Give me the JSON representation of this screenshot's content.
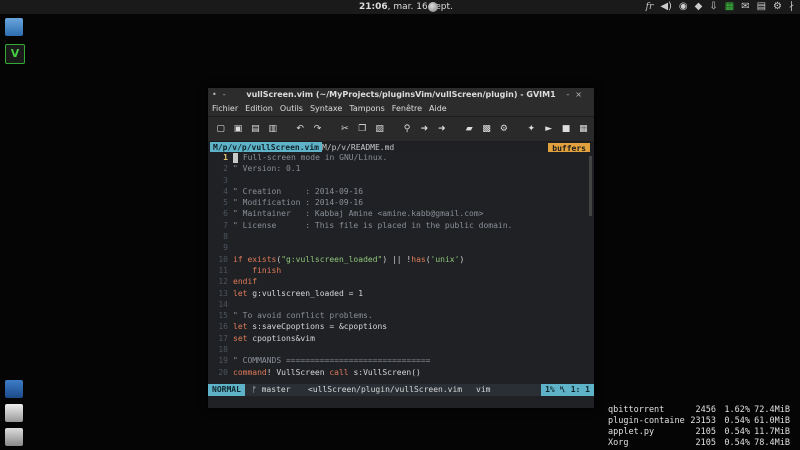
{
  "topbar": {
    "clock": "21:06",
    "date": ", mar. 16 sept.",
    "tray_kb": "fr"
  },
  "window": {
    "title": "vullScreen.vim (~/MyProjects/pluginsVim/vullScreen/plugin) - GVIM1",
    "menu": [
      "Fichier",
      "Edition",
      "Outils",
      "Syntaxe",
      "Tampons",
      "Fenêtre",
      "Aide"
    ],
    "tabs": {
      "active": "M/p/v/p/vullScreen.vim",
      "other": "M/p/v/README.md",
      "buffers": "buffers"
    },
    "statusline": {
      "mode": "NORMAL",
      "branch": "ᚠ master",
      "file": "<ullScreen/plugin/vullScreen.vim",
      "filetype": "vim",
      "position": "1% ␤   1:  1"
    }
  },
  "code_lines": [
    {
      "n": "1",
      "parts": [
        {
          "c": "cm",
          "t": "\" Full-screen mode in GNU/Linux."
        }
      ]
    },
    {
      "n": "2",
      "parts": [
        {
          "c": "cm",
          "t": "\" Version: 0.1"
        }
      ]
    },
    {
      "n": "3",
      "parts": []
    },
    {
      "n": "4",
      "parts": [
        {
          "c": "cm",
          "t": "\" Creation     : 2014-09-16"
        }
      ]
    },
    {
      "n": "5",
      "parts": [
        {
          "c": "cm",
          "t": "\" Modification : 2014-09-16"
        }
      ]
    },
    {
      "n": "6",
      "parts": [
        {
          "c": "cm",
          "t": "\" Maintainer   : Kabbaj Amine <amine.kabb@gmail.com>"
        }
      ]
    },
    {
      "n": "7",
      "parts": [
        {
          "c": "cm",
          "t": "\" License      : This file is placed in the public domain."
        }
      ]
    },
    {
      "n": "8",
      "parts": []
    },
    {
      "n": "9",
      "parts": []
    },
    {
      "n": "10",
      "parts": [
        {
          "c": "kw",
          "t": "if "
        },
        {
          "c": "kw",
          "t": "exists"
        },
        {
          "c": "op",
          "t": "("
        },
        {
          "c": "str",
          "t": "\"g:vullscreen_loaded\""
        },
        {
          "c": "op",
          "t": ") || !"
        },
        {
          "c": "kw",
          "t": "has"
        },
        {
          "c": "op",
          "t": "("
        },
        {
          "c": "str",
          "t": "'unix'"
        },
        {
          "c": "op",
          "t": ")"
        }
      ]
    },
    {
      "n": "11",
      "parts": [
        {
          "c": "kw",
          "t": "    finish"
        }
      ]
    },
    {
      "n": "12",
      "parts": [
        {
          "c": "kw",
          "t": "endif"
        }
      ]
    },
    {
      "n": "13",
      "parts": [
        {
          "c": "kw",
          "t": "let "
        },
        {
          "c": "plain",
          "t": "g:vullscreen_loaded = 1"
        }
      ]
    },
    {
      "n": "14",
      "parts": []
    },
    {
      "n": "15",
      "parts": [
        {
          "c": "cm",
          "t": "\" To avoid conflict problems."
        }
      ]
    },
    {
      "n": "16",
      "parts": [
        {
          "c": "kw",
          "t": "let "
        },
        {
          "c": "plain",
          "t": "s:saveCpoptions = &cpoptions"
        }
      ]
    },
    {
      "n": "17",
      "parts": [
        {
          "c": "kw",
          "t": "set "
        },
        {
          "c": "plain",
          "t": "cpoptions&vim"
        }
      ]
    },
    {
      "n": "18",
      "parts": []
    },
    {
      "n": "19",
      "parts": [
        {
          "c": "cm",
          "t": "\" COMMANDS =============================="
        }
      ]
    },
    {
      "n": "20",
      "parts": [
        {
          "c": "kw",
          "t": "command"
        },
        {
          "c": "plain",
          "t": "! VullScreen "
        },
        {
          "c": "kw",
          "t": "call "
        },
        {
          "c": "plain",
          "t": "s:VullScreen()"
        }
      ]
    }
  ],
  "processes": [
    {
      "name": "qbittorrent",
      "pid": "2456",
      "cpu": "1.62%",
      "mem": "72.4MiB"
    },
    {
      "name": "plugin-containe",
      "pid": "23153",
      "cpu": "0.54%",
      "mem": "61.0MiB"
    },
    {
      "name": "applet.py",
      "pid": "2105",
      "cpu": "0.54%",
      "mem": "11.7MiB"
    },
    {
      "name": "Xorg",
      "pid": "2105",
      "cpu": "0.54%",
      "mem": "78.4MiB"
    }
  ]
}
